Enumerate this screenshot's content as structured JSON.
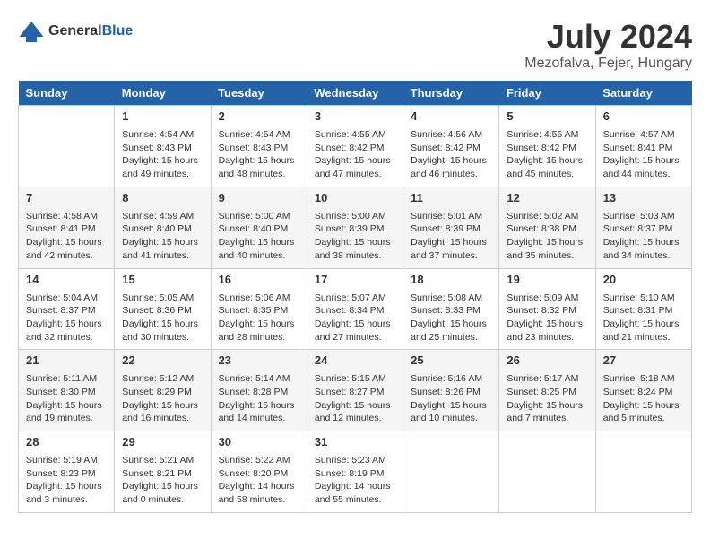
{
  "logo": {
    "general": "General",
    "blue": "Blue"
  },
  "title": "July 2024",
  "subtitle": "Mezofalva, Fejer, Hungary",
  "headers": [
    "Sunday",
    "Monday",
    "Tuesday",
    "Wednesday",
    "Thursday",
    "Friday",
    "Saturday"
  ],
  "weeks": [
    [
      {
        "date": "",
        "sunrise": "",
        "sunset": "",
        "daylight": ""
      },
      {
        "date": "1",
        "sunrise": "Sunrise: 4:54 AM",
        "sunset": "Sunset: 8:43 PM",
        "daylight": "Daylight: 15 hours and 49 minutes."
      },
      {
        "date": "2",
        "sunrise": "Sunrise: 4:54 AM",
        "sunset": "Sunset: 8:43 PM",
        "daylight": "Daylight: 15 hours and 48 minutes."
      },
      {
        "date": "3",
        "sunrise": "Sunrise: 4:55 AM",
        "sunset": "Sunset: 8:42 PM",
        "daylight": "Daylight: 15 hours and 47 minutes."
      },
      {
        "date": "4",
        "sunrise": "Sunrise: 4:56 AM",
        "sunset": "Sunset: 8:42 PM",
        "daylight": "Daylight: 15 hours and 46 minutes."
      },
      {
        "date": "5",
        "sunrise": "Sunrise: 4:56 AM",
        "sunset": "Sunset: 8:42 PM",
        "daylight": "Daylight: 15 hours and 45 minutes."
      },
      {
        "date": "6",
        "sunrise": "Sunrise: 4:57 AM",
        "sunset": "Sunset: 8:41 PM",
        "daylight": "Daylight: 15 hours and 44 minutes."
      }
    ],
    [
      {
        "date": "7",
        "sunrise": "Sunrise: 4:58 AM",
        "sunset": "Sunset: 8:41 PM",
        "daylight": "Daylight: 15 hours and 42 minutes."
      },
      {
        "date": "8",
        "sunrise": "Sunrise: 4:59 AM",
        "sunset": "Sunset: 8:40 PM",
        "daylight": "Daylight: 15 hours and 41 minutes."
      },
      {
        "date": "9",
        "sunrise": "Sunrise: 5:00 AM",
        "sunset": "Sunset: 8:40 PM",
        "daylight": "Daylight: 15 hours and 40 minutes."
      },
      {
        "date": "10",
        "sunrise": "Sunrise: 5:00 AM",
        "sunset": "Sunset: 8:39 PM",
        "daylight": "Daylight: 15 hours and 38 minutes."
      },
      {
        "date": "11",
        "sunrise": "Sunrise: 5:01 AM",
        "sunset": "Sunset: 8:39 PM",
        "daylight": "Daylight: 15 hours and 37 minutes."
      },
      {
        "date": "12",
        "sunrise": "Sunrise: 5:02 AM",
        "sunset": "Sunset: 8:38 PM",
        "daylight": "Daylight: 15 hours and 35 minutes."
      },
      {
        "date": "13",
        "sunrise": "Sunrise: 5:03 AM",
        "sunset": "Sunset: 8:37 PM",
        "daylight": "Daylight: 15 hours and 34 minutes."
      }
    ],
    [
      {
        "date": "14",
        "sunrise": "Sunrise: 5:04 AM",
        "sunset": "Sunset: 8:37 PM",
        "daylight": "Daylight: 15 hours and 32 minutes."
      },
      {
        "date": "15",
        "sunrise": "Sunrise: 5:05 AM",
        "sunset": "Sunset: 8:36 PM",
        "daylight": "Daylight: 15 hours and 30 minutes."
      },
      {
        "date": "16",
        "sunrise": "Sunrise: 5:06 AM",
        "sunset": "Sunset: 8:35 PM",
        "daylight": "Daylight: 15 hours and 28 minutes."
      },
      {
        "date": "17",
        "sunrise": "Sunrise: 5:07 AM",
        "sunset": "Sunset: 8:34 PM",
        "daylight": "Daylight: 15 hours and 27 minutes."
      },
      {
        "date": "18",
        "sunrise": "Sunrise: 5:08 AM",
        "sunset": "Sunset: 8:33 PM",
        "daylight": "Daylight: 15 hours and 25 minutes."
      },
      {
        "date": "19",
        "sunrise": "Sunrise: 5:09 AM",
        "sunset": "Sunset: 8:32 PM",
        "daylight": "Daylight: 15 hours and 23 minutes."
      },
      {
        "date": "20",
        "sunrise": "Sunrise: 5:10 AM",
        "sunset": "Sunset: 8:31 PM",
        "daylight": "Daylight: 15 hours and 21 minutes."
      }
    ],
    [
      {
        "date": "21",
        "sunrise": "Sunrise: 5:11 AM",
        "sunset": "Sunset: 8:30 PM",
        "daylight": "Daylight: 15 hours and 19 minutes."
      },
      {
        "date": "22",
        "sunrise": "Sunrise: 5:12 AM",
        "sunset": "Sunset: 8:29 PM",
        "daylight": "Daylight: 15 hours and 16 minutes."
      },
      {
        "date": "23",
        "sunrise": "Sunrise: 5:14 AM",
        "sunset": "Sunset: 8:28 PM",
        "daylight": "Daylight: 15 hours and 14 minutes."
      },
      {
        "date": "24",
        "sunrise": "Sunrise: 5:15 AM",
        "sunset": "Sunset: 8:27 PM",
        "daylight": "Daylight: 15 hours and 12 minutes."
      },
      {
        "date": "25",
        "sunrise": "Sunrise: 5:16 AM",
        "sunset": "Sunset: 8:26 PM",
        "daylight": "Daylight: 15 hours and 10 minutes."
      },
      {
        "date": "26",
        "sunrise": "Sunrise: 5:17 AM",
        "sunset": "Sunset: 8:25 PM",
        "daylight": "Daylight: 15 hours and 7 minutes."
      },
      {
        "date": "27",
        "sunrise": "Sunrise: 5:18 AM",
        "sunset": "Sunset: 8:24 PM",
        "daylight": "Daylight: 15 hours and 5 minutes."
      }
    ],
    [
      {
        "date": "28",
        "sunrise": "Sunrise: 5:19 AM",
        "sunset": "Sunset: 8:23 PM",
        "daylight": "Daylight: 15 hours and 3 minutes."
      },
      {
        "date": "29",
        "sunrise": "Sunrise: 5:21 AM",
        "sunset": "Sunset: 8:21 PM",
        "daylight": "Daylight: 15 hours and 0 minutes."
      },
      {
        "date": "30",
        "sunrise": "Sunrise: 5:22 AM",
        "sunset": "Sunset: 8:20 PM",
        "daylight": "Daylight: 14 hours and 58 minutes."
      },
      {
        "date": "31",
        "sunrise": "Sunrise: 5:23 AM",
        "sunset": "Sunset: 8:19 PM",
        "daylight": "Daylight: 14 hours and 55 minutes."
      },
      {
        "date": "",
        "sunrise": "",
        "sunset": "",
        "daylight": ""
      },
      {
        "date": "",
        "sunrise": "",
        "sunset": "",
        "daylight": ""
      },
      {
        "date": "",
        "sunrise": "",
        "sunset": "",
        "daylight": ""
      }
    ]
  ]
}
